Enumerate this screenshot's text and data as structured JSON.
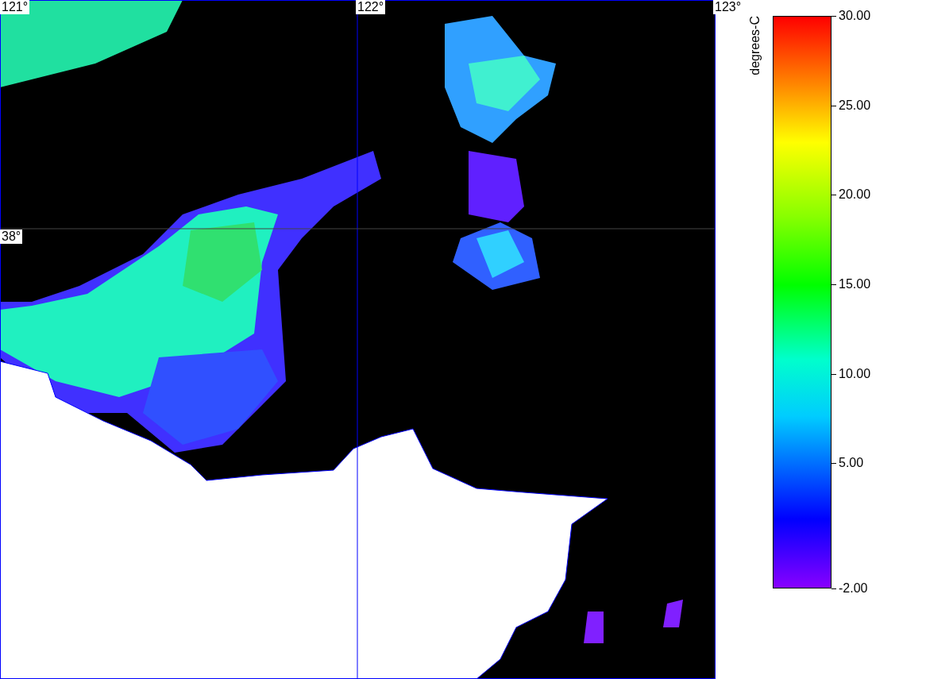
{
  "map": {
    "longitude_labels": [
      "121°",
      "122°",
      "123°"
    ],
    "latitude_labels": [
      "38°"
    ]
  },
  "colorbar": {
    "title": "degrees-C",
    "ticks": [
      {
        "label": "30.00"
      },
      {
        "label": "25.00"
      },
      {
        "label": "20.00"
      },
      {
        "label": "15.00"
      },
      {
        "label": "10.00"
      },
      {
        "label": "5.00"
      },
      {
        "label": "-2.00"
      }
    ]
  }
}
